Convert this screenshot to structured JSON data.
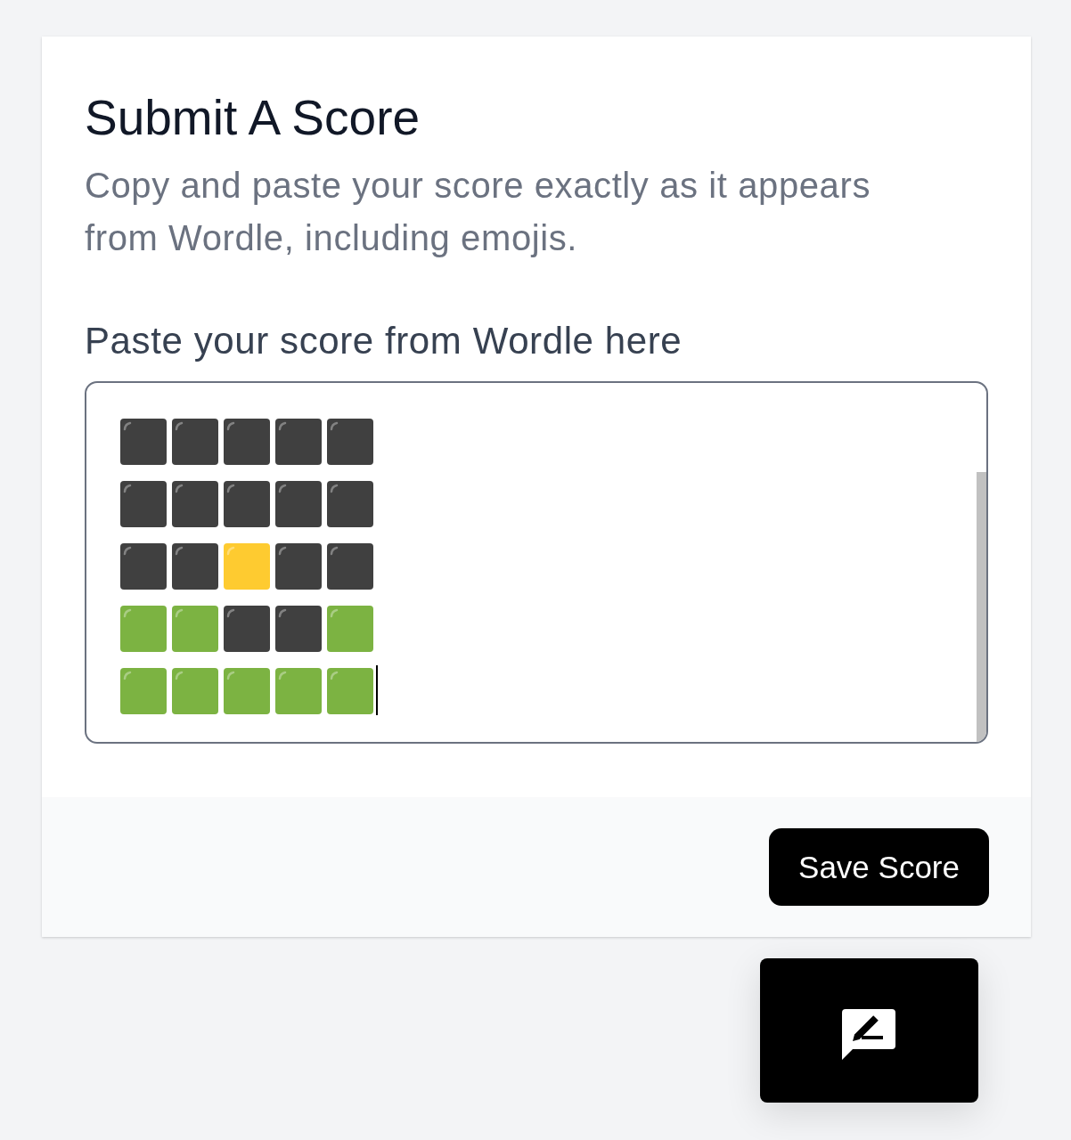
{
  "card": {
    "title": "Submit A Score",
    "description": "Copy and paste your score exactly as it appears from Wordle, including emojis.",
    "field": {
      "label": "Paste your score from Wordle here",
      "focused": true,
      "rows": [
        {
          "tiles": [
            {
              "color": "#404040"
            },
            {
              "color": "#404040"
            },
            {
              "color": "#404040"
            },
            {
              "color": "#404040"
            },
            {
              "color": "#404040"
            }
          ]
        },
        {
          "tiles": [
            {
              "color": "#404040"
            },
            {
              "color": "#404040"
            },
            {
              "color": "#404040"
            },
            {
              "color": "#404040"
            },
            {
              "color": "#404040"
            }
          ]
        },
        {
          "tiles": [
            {
              "color": "#404040"
            },
            {
              "color": "#404040"
            },
            {
              "color": "#fecb30"
            },
            {
              "color": "#404040"
            },
            {
              "color": "#404040"
            }
          ]
        },
        {
          "tiles": [
            {
              "color": "#7cb342"
            },
            {
              "color": "#7cb342"
            },
            {
              "color": "#404040"
            },
            {
              "color": "#404040"
            },
            {
              "color": "#7cb342"
            }
          ]
        },
        {
          "tiles": [
            {
              "color": "#7cb342"
            },
            {
              "color": "#7cb342"
            },
            {
              "color": "#7cb342"
            },
            {
              "color": "#7cb342"
            },
            {
              "color": "#7cb342"
            }
          ]
        }
      ]
    },
    "save_button": "Save Score"
  }
}
